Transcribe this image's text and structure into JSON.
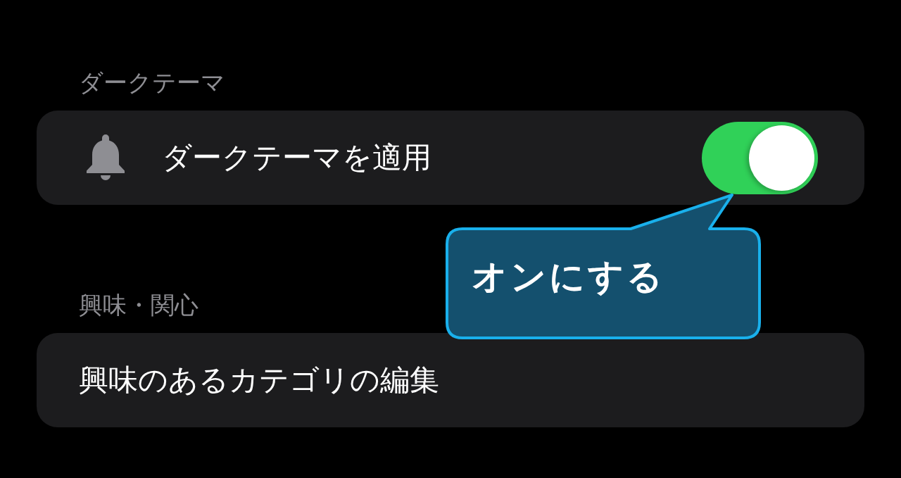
{
  "sections": [
    {
      "header": "ダークテーマ",
      "rows": [
        {
          "kind": "toggle",
          "label": "ダークテーマを適用",
          "on": true
        }
      ]
    },
    {
      "header": "興味・関心",
      "rows": [
        {
          "kind": "link",
          "label": "興味のあるカテゴリの編集"
        }
      ]
    }
  ],
  "callout": {
    "text": "オンにする"
  }
}
